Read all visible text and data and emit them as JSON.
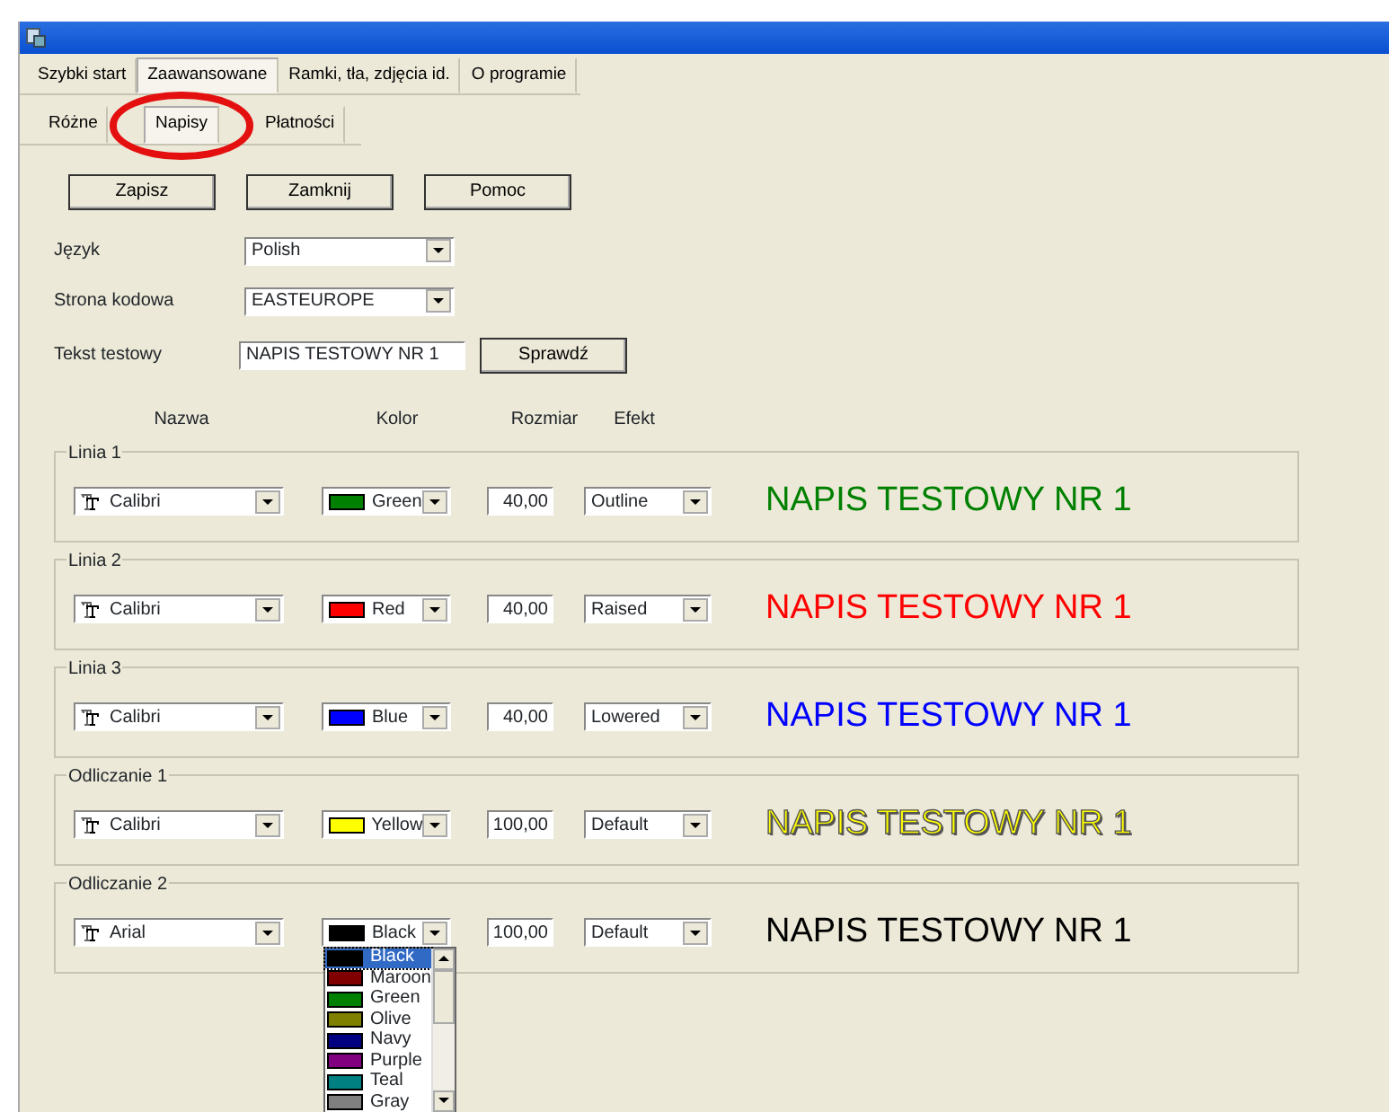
{
  "tabs": [
    {
      "label": "Szybki start",
      "selected": false
    },
    {
      "label": "Zaawansowane",
      "selected": true
    },
    {
      "label": "Ramki, tła, zdjęcia id.",
      "selected": false
    },
    {
      "label": "O programie",
      "selected": false
    }
  ],
  "subtabs": [
    {
      "label": "Różne",
      "selected": false
    },
    {
      "label": "Napisy",
      "selected": true
    },
    {
      "label": "Płatności",
      "selected": false
    }
  ],
  "buttons": [
    "Zapisz",
    "Zamknij",
    "Pomoc"
  ],
  "settings": [
    {
      "kind": "select",
      "label": "Język",
      "value": "Polish"
    },
    {
      "kind": "select",
      "label": "Strona kodowa",
      "value": "EASTEUROPE"
    },
    {
      "kind": "text",
      "label": "Tekst testowy",
      "value": "NAPIS TESTOWY NR 1",
      "button": "Sprawdź"
    }
  ],
  "columns": [
    "Nazwa",
    "Kolor",
    "Rozmiar",
    "Efekt"
  ],
  "groups": [
    {
      "title": "Linia 1",
      "font": "Calibri",
      "color_name": "Green",
      "color": "#008000",
      "size": "40,00",
      "effect": "Outline",
      "preview": "NAPIS TESTOWY NR 1"
    },
    {
      "title": "Linia 2",
      "font": "Calibri",
      "color_name": "Red",
      "color": "#ff0000",
      "size": "40,00",
      "effect": "Raised",
      "preview": "NAPIS TESTOWY NR 1"
    },
    {
      "title": "Linia 3",
      "font": "Calibri",
      "color_name": "Blue",
      "color": "#0000ff",
      "size": "40,00",
      "effect": "Lowered",
      "preview": "NAPIS TESTOWY NR 1"
    },
    {
      "title": "Odliczanie 1",
      "font": "Calibri",
      "color_name": "Yellow",
      "color": "#ffff00",
      "size": "100,00",
      "effect": "Default",
      "preview": "NAPIS TESTOWY NR 1"
    },
    {
      "title": "Odliczanie 2",
      "font": "Arial",
      "color_name": "Black",
      "color": "#000000",
      "size": "100,00",
      "effect": "Default",
      "preview": "NAPIS TESTOWY NR 1",
      "dropdown": [
        {
          "label": "Black",
          "color": "#000000",
          "selected": true
        },
        {
          "label": "Maroon",
          "color": "#800000",
          "selected": false
        },
        {
          "label": "Green",
          "color": "#008000",
          "selected": false
        },
        {
          "label": "Olive",
          "color": "#808000",
          "selected": false
        },
        {
          "label": "Navy",
          "color": "#000080",
          "selected": false
        },
        {
          "label": "Purple",
          "color": "#800080",
          "selected": false
        },
        {
          "label": "Teal",
          "color": "#008080",
          "selected": false
        },
        {
          "label": "Gray",
          "color": "#808080",
          "selected": false
        }
      ]
    }
  ]
}
